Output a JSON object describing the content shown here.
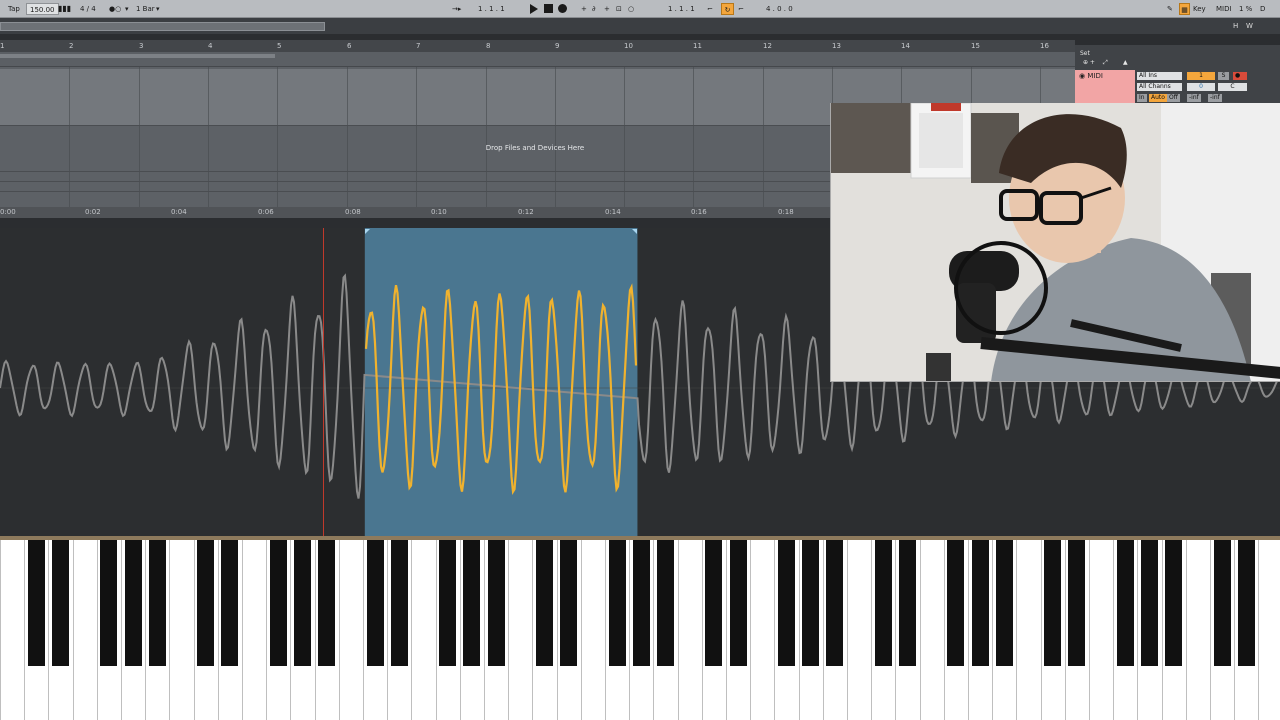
{
  "toolbar": {
    "tap_label": "Tap",
    "tempo": "150.00",
    "time_signature": "4 / 4",
    "quantize": "1 Bar",
    "arrangement_position": "1 .  1 .  1",
    "punch_position": "1 .  1 .  1",
    "loop_length": "4 .  0 .  0",
    "key_label": "Key",
    "midi_label": "MIDI",
    "cpu_load": "1 %",
    "disk_indicator": "D"
  },
  "overview": {
    "h_label": "H",
    "w_label": "W"
  },
  "beat_ruler": [
    "1",
    "2",
    "3",
    "4",
    "5",
    "6",
    "7",
    "8",
    "9",
    "10",
    "11",
    "12",
    "13",
    "14",
    "15",
    "16"
  ],
  "time_ruler": [
    "0:00",
    "0:02",
    "0:04",
    "0:06",
    "0:08",
    "0:10",
    "0:12",
    "0:14",
    "0:16",
    "0:18"
  ],
  "arrangement": {
    "drop_message": "Drop Files and Devices Here"
  },
  "track_panel": {
    "set_label": "Set",
    "track_name": "MIDI",
    "input_type": "All Ins",
    "input_channel": "All Channs",
    "monitor_in": "In",
    "monitor_auto": "Auto",
    "monitor_off": "Off",
    "track_number": "1",
    "solo": "S",
    "volume": "0",
    "pan": "C",
    "meter_left": "-inf",
    "meter_right": "-inf"
  },
  "colors": {
    "selected_region": "#4a7690",
    "selected_wave": "#f0b22e",
    "waveform": "#8a8a8a",
    "midi_clip": "#f2a5a5",
    "playhead": "#c0392b"
  },
  "waveform": {
    "selection_start": 0.285,
    "selection_end": 0.498
  }
}
